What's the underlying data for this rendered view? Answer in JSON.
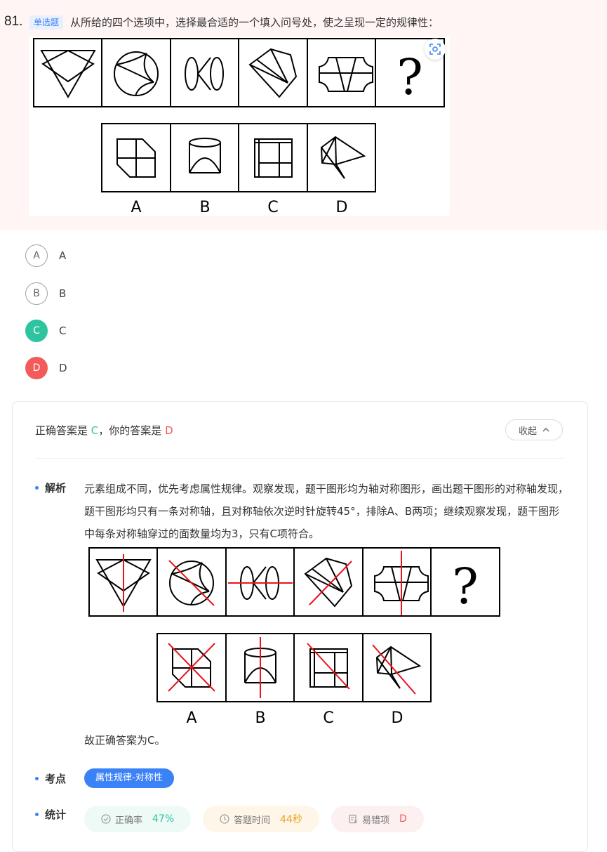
{
  "question": {
    "number": "81.",
    "type_tag": "单选题",
    "text": "从所给的四个选项中，选择最合适的一个填入问号处，使之呈现一定的规律性：",
    "figure_question_mark": "?",
    "figure_option_letters": [
      "A",
      "B",
      "C",
      "D"
    ]
  },
  "options": [
    {
      "letter": "A",
      "label": "A",
      "state": "normal"
    },
    {
      "letter": "B",
      "label": "B",
      "state": "normal"
    },
    {
      "letter": "C",
      "label": "C",
      "state": "correct"
    },
    {
      "letter": "D",
      "label": "D",
      "state": "wrong"
    }
  ],
  "answer": {
    "prefix": "正确答案是",
    "correct": "C",
    "separator": "，你的答案是",
    "yours": "D",
    "collapse_label": "收起"
  },
  "analysis": {
    "label": "解析",
    "text": "元素组成不同，优先考虑属性规律。观察发现，题干图形均为轴对称图形，画出题干图形的对称轴发现，题干图形均只有一条对称轴，且对称轴依次逆时针旋转45°，排除A、B两项；继续观察发现，题干图形中每条对称轴穿过的面数量均为3，只有C项符合。",
    "conclusion": "故正确答案为C。",
    "figure_question_mark": "?",
    "figure_option_letters": [
      "A",
      "B",
      "C",
      "D"
    ]
  },
  "knowledge_point": {
    "label": "考点",
    "tag": "属性规律-对称性"
  },
  "stats": {
    "label": "统计",
    "items": [
      {
        "icon": "check-circle-icon",
        "label": "正确率",
        "value": "47%",
        "color": "#2ec4a0",
        "bg": "#eefaf6"
      },
      {
        "icon": "clock-icon",
        "label": "答题时间",
        "value": "44秒",
        "color": "#f0a020",
        "bg": "#fef6e8"
      },
      {
        "icon": "error-book-icon",
        "label": "易错项",
        "value": "D",
        "color": "#f35a5a",
        "bg": "#fdf0f0"
      }
    ]
  },
  "colors": {
    "correct": "#2ec4a0",
    "wrong": "#f35a5a",
    "accent": "#3b82f6",
    "axis_line": "#e8141c"
  }
}
